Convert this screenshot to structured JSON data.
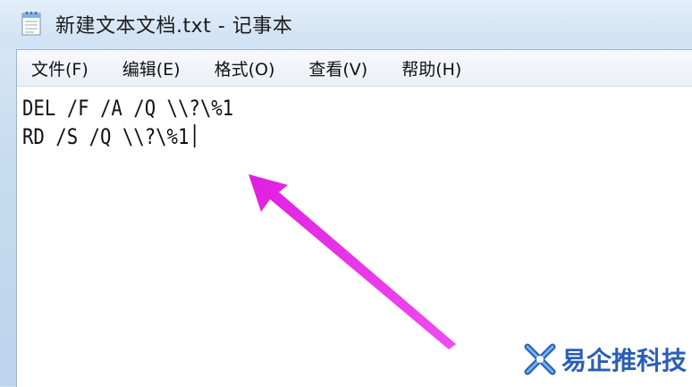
{
  "window": {
    "title": "新建文本文档.txt - 记事本"
  },
  "menu": {
    "items": [
      "文件(F)",
      "编辑(E)",
      "格式(O)",
      "查看(V)",
      "帮助(H)"
    ]
  },
  "editor": {
    "lines": [
      "DEL /F /A /Q \\\\?\\%1",
      "RD /S /Q \\\\?\\%1"
    ]
  },
  "annotation": {
    "arrow_color": "#e21fe0",
    "icon": "arrow-annotation"
  },
  "watermark": {
    "text": "易企推科技",
    "logo_icon": "x-logo-icon",
    "color": "#2a5fb3"
  }
}
